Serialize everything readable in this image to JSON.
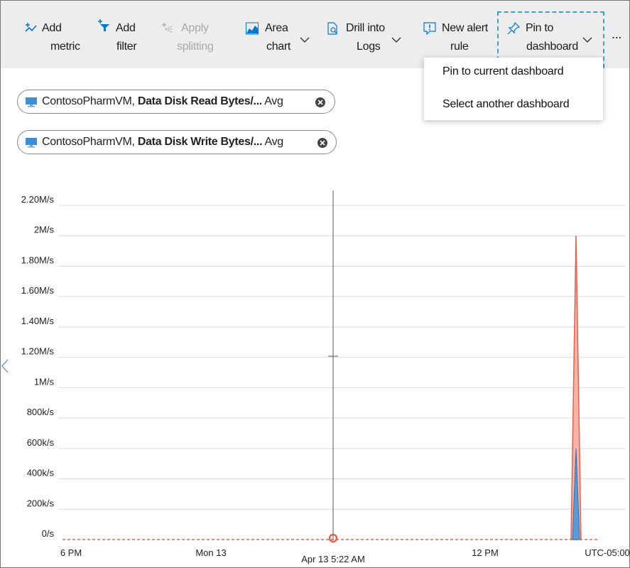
{
  "toolbar": {
    "add_metric": {
      "line1": "Add",
      "line2": "metric"
    },
    "add_filter": {
      "line1": "Add",
      "line2": "filter"
    },
    "apply_splitting": {
      "line1": "Apply",
      "line2": "splitting"
    },
    "area_chart": {
      "line1": "Area",
      "line2": "chart"
    },
    "drill_logs": {
      "line1": "Drill into",
      "line2": "Logs"
    },
    "new_alert": {
      "line1": "New alert",
      "line2": "rule"
    },
    "pin_dashboard": {
      "line1": "Pin to",
      "line2": "dashboard"
    },
    "more": "...",
    "icons": [
      "add-metric-icon",
      "add-filter-icon",
      "apply-splitting-icon",
      "area-chart-icon",
      "drill-logs-icon",
      "new-alert-icon",
      "pin-icon",
      "chevron-down-icon"
    ],
    "colors": {
      "background": "#ededed",
      "accent": "#0078d4",
      "pin_outline": "#3da0c8"
    }
  },
  "pin_menu": {
    "items": [
      "Pin to current dashboard",
      "Select another dashboard"
    ]
  },
  "metrics": [
    {
      "resource": "ContosoPharmVM,",
      "metric": "Data Disk Read Bytes/...",
      "agg": "Avg"
    },
    {
      "resource": "ContosoPharmVM,",
      "metric": "Data Disk Write Bytes/...",
      "agg": "Avg"
    }
  ],
  "chart_data": {
    "type": "area",
    "y_ticks": [
      "0/s",
      "200k/s",
      "400k/s",
      "600k/s",
      "800k/s",
      "1M/s",
      "1.20M/s",
      "1.40M/s",
      "1.60M/s",
      "1.80M/s",
      "2M/s",
      "2.20M/s"
    ],
    "ylim": [
      0,
      2200000
    ],
    "x_ticks": [
      "6 PM",
      "Mon 13",
      "12 PM",
      "UTC-05:00"
    ],
    "cursor_label": "Apr 13 5:22 AM",
    "grid": true,
    "colors": {
      "read": "#e8604c",
      "write": "#4f8fd6",
      "read_fill": "#f6b3a8",
      "write_fill": "#5b9bd5"
    },
    "series": [
      {
        "name": "Data Disk Read Bytes/...",
        "x": [
          "6 PM",
          "Mon 13",
          "Apr 13 5:22 AM",
          "12 PM",
          "spike-start",
          "spike-peak",
          "spike-end"
        ],
        "values": [
          0,
          0,
          0,
          0,
          0,
          2000000,
          0
        ]
      },
      {
        "name": "Data Disk Write Bytes/...",
        "x": [
          "6 PM",
          "Mon 13",
          "Apr 13 5:22 AM",
          "12 PM",
          "spike-start",
          "spike-peak",
          "spike-end"
        ],
        "values": [
          0,
          0,
          0,
          0,
          0,
          600000,
          0
        ]
      }
    ]
  }
}
